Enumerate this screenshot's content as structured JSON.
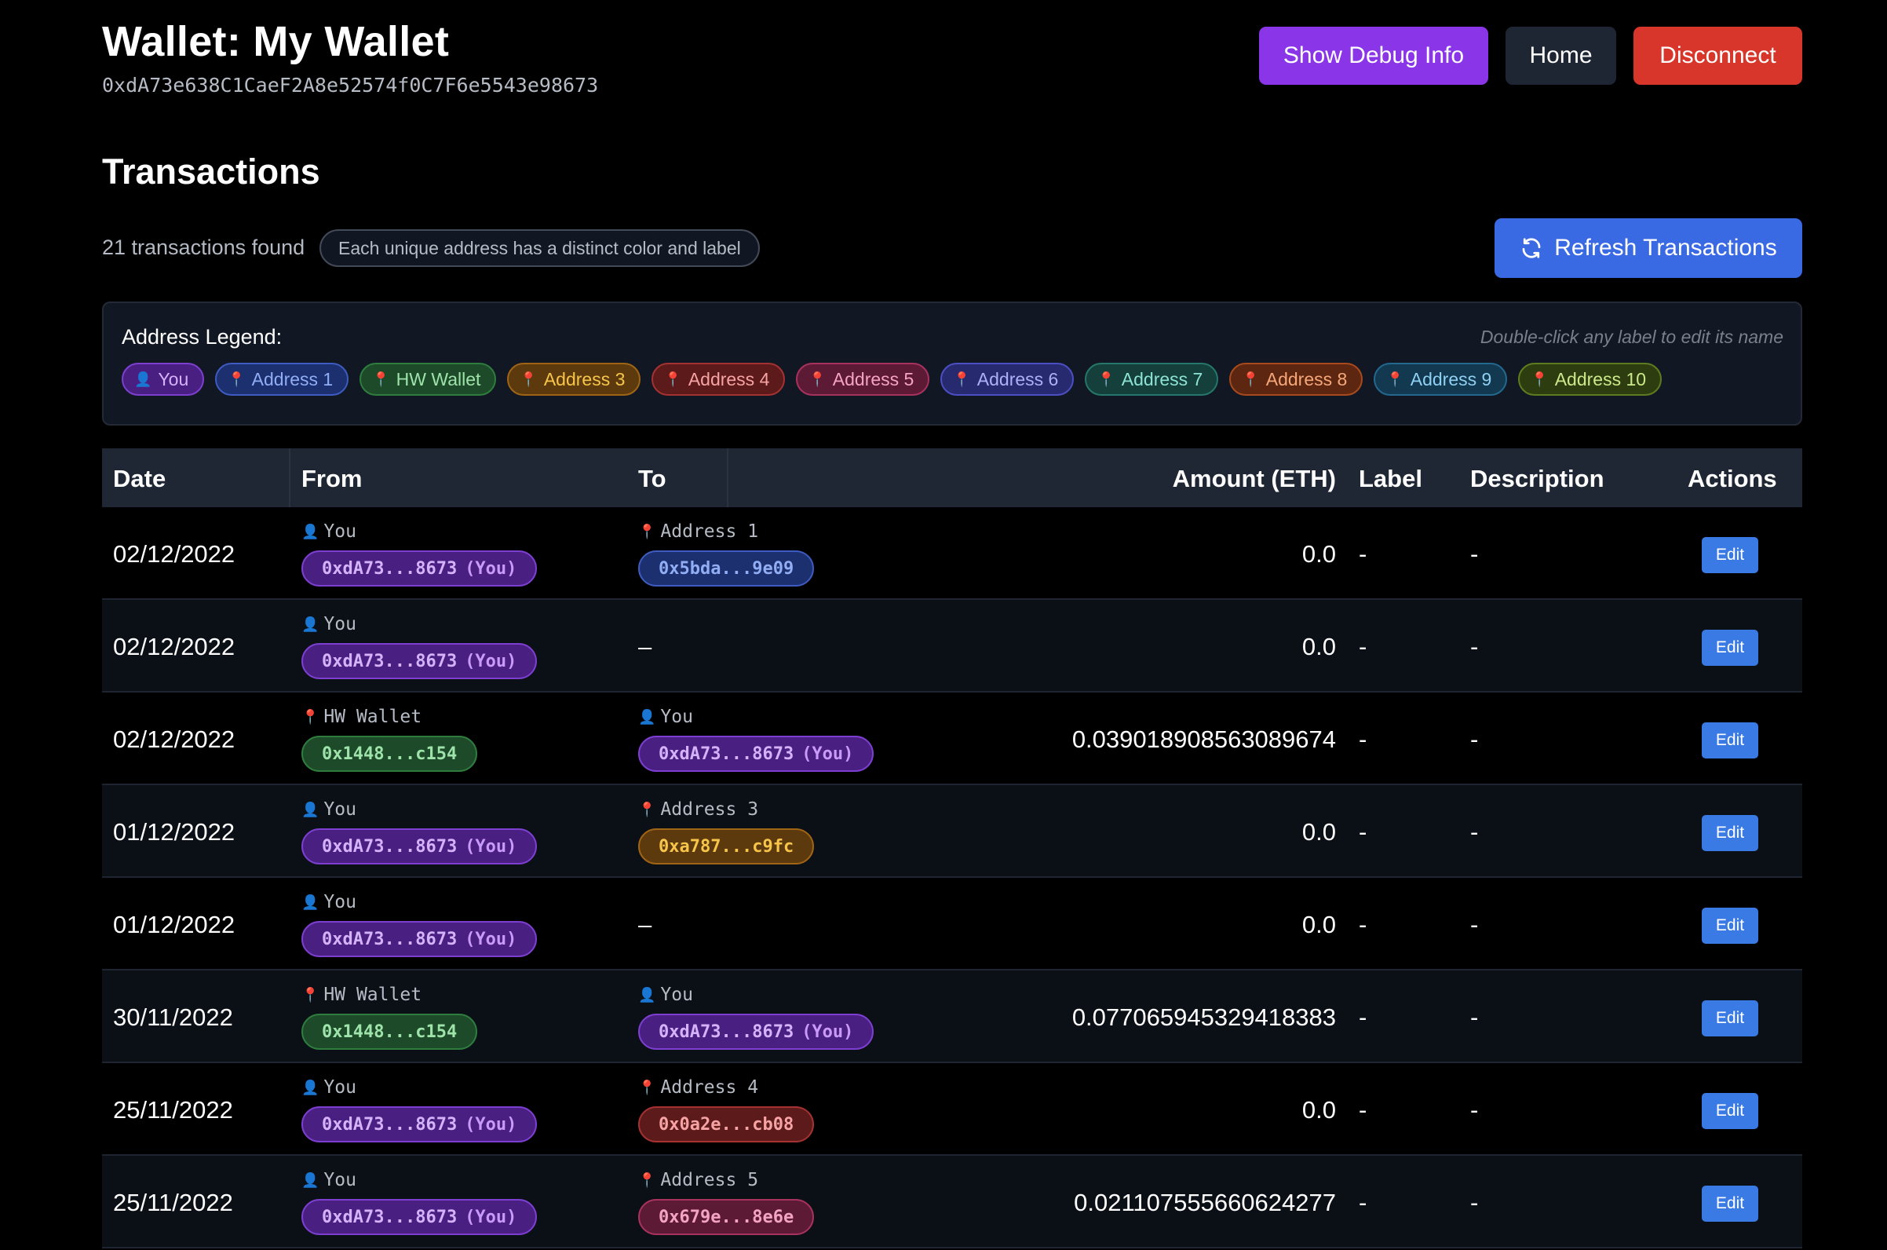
{
  "header": {
    "title": "Wallet: My Wallet",
    "address": "0xdA73e638C1CaeF2A8e52574f0C7F6e5543e98673",
    "buttons": {
      "debug": "Show Debug Info",
      "home": "Home",
      "disconnect": "Disconnect"
    }
  },
  "transactions": {
    "title": "Transactions",
    "count_text": "21 transactions found",
    "hint": "Each unique address has a distinct color and label",
    "refresh_label": "Refresh Transactions"
  },
  "legend": {
    "title": "Address Legend:",
    "hint": "Double-click any label to edit its name",
    "items": [
      {
        "label": "You",
        "icon": "person-icon",
        "color": "#7d3fd0"
      },
      {
        "label": "Address 1",
        "icon": "pin-icon",
        "color": "#3d5bc0"
      },
      {
        "label": "HW Wallet",
        "icon": "pin-icon",
        "color": "#2e7d3f"
      },
      {
        "label": "Address 3",
        "icon": "pin-icon",
        "color": "#a06415"
      },
      {
        "label": "Address 4",
        "icon": "pin-icon",
        "color": "#a43232"
      },
      {
        "label": "Address 5",
        "icon": "pin-icon",
        "color": "#a8325e"
      },
      {
        "label": "Address 6",
        "icon": "pin-icon",
        "color": "#4c4fc4"
      },
      {
        "label": "Address 7",
        "icon": "pin-icon",
        "color": "#24776a"
      },
      {
        "label": "Address 8",
        "icon": "pin-icon",
        "color": "#a84a1e"
      },
      {
        "label": "Address 9",
        "icon": "pin-icon",
        "color": "#22688f"
      },
      {
        "label": "Address 10",
        "icon": "pin-icon",
        "color": "#5e7c1f"
      }
    ]
  },
  "table": {
    "headers": {
      "date": "Date",
      "from": "From",
      "to": "To",
      "amount": "Amount (ETH)",
      "label": "Label",
      "description": "Description",
      "actions": "Actions"
    },
    "edit_label": "Edit",
    "you_suffix": "(You)",
    "rows": [
      {
        "date": "02/12/2022",
        "from_label": "You",
        "from_addr": "0xdA73...8673",
        "to_label": "Address 1",
        "to_addr": "0x5bda...9e09",
        "amount": "0.0",
        "label": "-",
        "description": "-"
      },
      {
        "date": "02/12/2022",
        "from_label": "You",
        "from_addr": "0xdA73...8673",
        "to_text": "–",
        "amount": "0.0",
        "label": "-",
        "description": "-"
      },
      {
        "date": "02/12/2022",
        "from_label": "HW Wallet",
        "from_addr": "0x1448...c154",
        "to_label": "You",
        "to_addr": "0xdA73...8673",
        "amount": "0.039018908563089674",
        "label": "-",
        "description": "-"
      },
      {
        "date": "01/12/2022",
        "from_label": "You",
        "from_addr": "0xdA73...8673",
        "to_label": "Address 3",
        "to_addr": "0xa787...c9fc",
        "amount": "0.0",
        "label": "-",
        "description": "-"
      },
      {
        "date": "01/12/2022",
        "from_label": "You",
        "from_addr": "0xdA73...8673",
        "to_text": "–",
        "amount": "0.0",
        "label": "-",
        "description": "-"
      },
      {
        "date": "30/11/2022",
        "from_label": "HW Wallet",
        "from_addr": "0x1448...c154",
        "to_label": "You",
        "to_addr": "0xdA73...8673",
        "amount": "0.077065945329418383",
        "label": "-",
        "description": "-"
      },
      {
        "date": "25/11/2022",
        "from_label": "You",
        "from_addr": "0xdA73...8673",
        "to_label": "Address 4",
        "to_addr": "0x0a2e...cb08",
        "amount": "0.0",
        "label": "-",
        "description": "-"
      },
      {
        "date": "25/11/2022",
        "from_label": "You",
        "from_addr": "0xdA73...8673",
        "to_label": "Address 5",
        "to_addr": "0x679e...8e6e",
        "amount": "0.021107555660624277",
        "label": "-",
        "description": "-"
      }
    ]
  }
}
